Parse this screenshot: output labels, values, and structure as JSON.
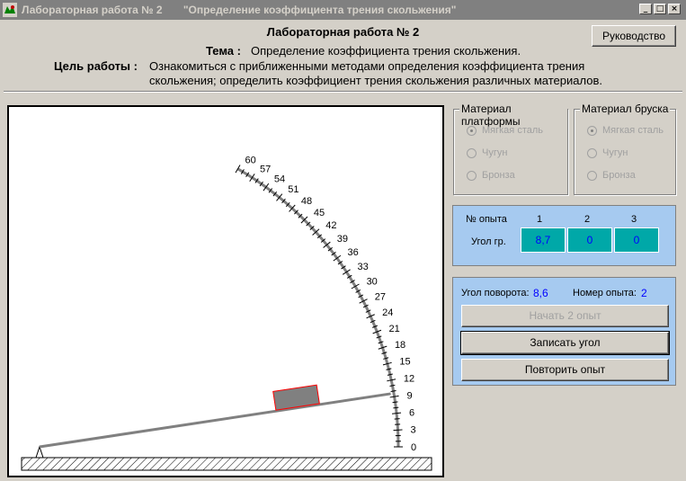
{
  "window": {
    "title": "Лабораторная работа № 2       \"Определение коэффициента трения скольжения\"",
    "controls": [
      "minimize-icon",
      "maximize-icon",
      "close-icon"
    ]
  },
  "header": {
    "title": "Лабораторная работа № 2",
    "topic_label": "Тема :",
    "topic_text": "Определение коэффициента трения скольжения.",
    "goal_label": "Цель работы :",
    "goal_text": "Ознакомиться с приближенными методами определения коэффициента трения скольжения; определить коэффициент трения скольжения различных материалов.",
    "manual_button": "Руководство"
  },
  "scale": {
    "labels": [
      "0",
      "3",
      "6",
      "9",
      "12",
      "15",
      "18",
      "21",
      "24",
      "27",
      "30",
      "33",
      "36",
      "39",
      "42",
      "45",
      "48",
      "51",
      "54",
      "57",
      "60"
    ]
  },
  "platform_material": {
    "title": "Материал платформы",
    "options": [
      "Мягкая сталь",
      "Чугун",
      "Бронза"
    ],
    "selected": "Мягкая сталь"
  },
  "bar_material": {
    "title": "Материал бруска",
    "options": [
      "Мягкая сталь",
      "Чугун",
      "Бронза"
    ],
    "selected": "Мягкая сталь"
  },
  "results": {
    "experiment_label": "№ опыта",
    "angle_label": "Угол гр.",
    "columns": [
      "1",
      "2",
      "3"
    ],
    "values": [
      "8,7",
      "0",
      "0"
    ]
  },
  "controls": {
    "rotation_label": "Угол поворота:",
    "rotation_value": "8,6",
    "experiment_label": "Номер опыта:",
    "experiment_value": "2",
    "start_button": "Начать 2 опыт",
    "record_button": "Записать угол",
    "repeat_button": "Повторить опыт"
  },
  "colors": {
    "titlebar": "#808080",
    "panel_blue": "#a6caf0",
    "cell_teal": "#00a8a8",
    "value_blue": "#0000ff",
    "block_fill": "#808080",
    "block_border": "#ff0000"
  },
  "plane_angle_deg": 8.6
}
